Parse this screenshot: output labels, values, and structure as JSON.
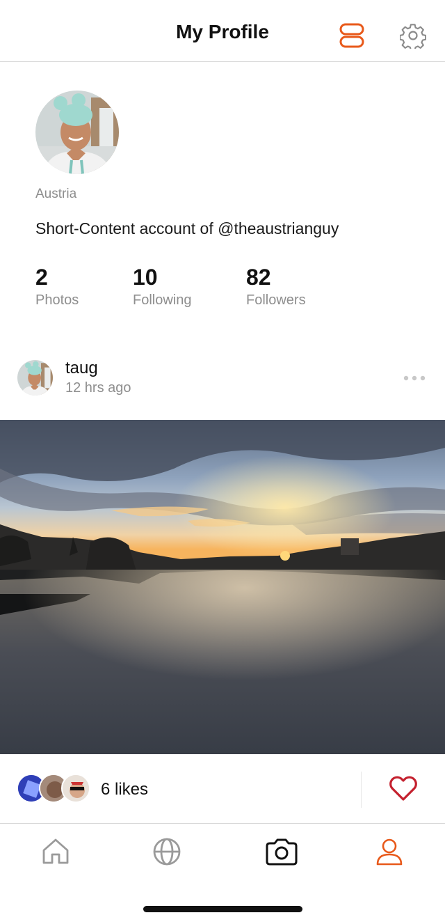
{
  "header": {
    "title": "My Profile"
  },
  "profile": {
    "location": "Austria",
    "bio": "Short-Content account of @theaustrianguy",
    "stats": {
      "photos_count": "2",
      "photos_label": "Photos",
      "following_count": "10",
      "following_label": "Following",
      "followers_count": "82",
      "followers_label": "Followers"
    }
  },
  "post": {
    "username": "taug",
    "time": "12 hrs ago",
    "likes_text": "6 likes"
  },
  "tabs": [
    {
      "icon": "home-icon",
      "active": false
    },
    {
      "icon": "globe-icon",
      "active": false
    },
    {
      "icon": "camera-icon",
      "active": false
    },
    {
      "icon": "user-icon",
      "active": true
    }
  ],
  "colors": {
    "accent": "#e8591a",
    "heart": "#c4202e",
    "muted_text": "#8e8e8e",
    "icon_gray": "#9a9a9a"
  }
}
